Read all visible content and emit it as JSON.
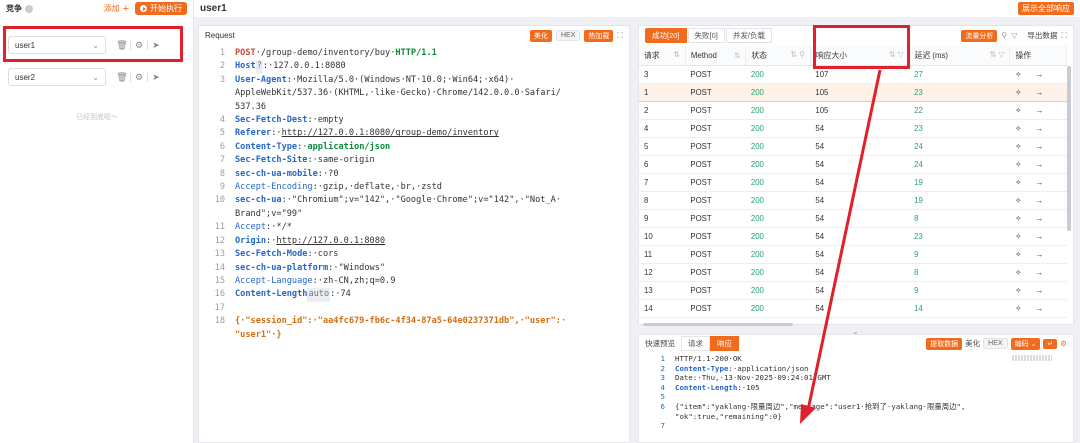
{
  "left": {
    "title": "竞争",
    "add_label": "添加",
    "run_label": "开始执行",
    "users": [
      {
        "name": "user1"
      },
      {
        "name": "user2"
      }
    ],
    "empty_hint": "已经到底啦～"
  },
  "header": {
    "title": "user1",
    "show_all_label": "展示全部响应"
  },
  "request": {
    "title": "Request",
    "tools": [
      "美化",
      "HEX",
      "热加载"
    ],
    "lines": [
      {
        "n": "1",
        "parts": [
          {
            "t": "POST",
            "c": "kw"
          },
          {
            "t": "·/group-demo/inventory/buy·",
            "c": ""
          },
          {
            "t": "HTTP/1.1",
            "c": "green"
          }
        ]
      },
      {
        "n": "2",
        "parts": [
          {
            "t": "Host",
            "c": "hn"
          },
          {
            "t": "?",
            "c": "hl"
          },
          {
            "t": ":·127.0.0.1:8080",
            "c": ""
          }
        ]
      },
      {
        "n": "3",
        "parts": [
          {
            "t": "User-Agent",
            "c": "hn"
          },
          {
            "t": ":·Mozilla/5.0·(Windows·NT·10.0;·Win64;·x64)·",
            "c": ""
          }
        ]
      },
      {
        "n": "",
        "parts": [
          {
            "t": "AppleWebKit/537.36·(KHTML,·like·Gecko)·Chrome/142.0.0.0·Safari/",
            "c": ""
          }
        ]
      },
      {
        "n": "",
        "parts": [
          {
            "t": "537.36",
            "c": ""
          }
        ]
      },
      {
        "n": "4",
        "parts": [
          {
            "t": "Sec-Fetch-Dest",
            "c": "hn"
          },
          {
            "t": ":·empty",
            "c": ""
          }
        ]
      },
      {
        "n": "5",
        "parts": [
          {
            "t": "Referer",
            "c": "hn"
          },
          {
            "t": ":·",
            "c": ""
          },
          {
            "t": "http://127.0.0.1:8080/group-demo/inventory",
            "c": "ul"
          }
        ]
      },
      {
        "n": "6",
        "parts": [
          {
            "t": "Content-Type",
            "c": "hn"
          },
          {
            "t": ":·",
            "c": ""
          },
          {
            "t": "application/json",
            "c": "green"
          }
        ]
      },
      {
        "n": "7",
        "parts": [
          {
            "t": "Sec-Fetch-Site",
            "c": "hn"
          },
          {
            "t": ":·same-origin",
            "c": ""
          }
        ]
      },
      {
        "n": "8",
        "parts": [
          {
            "t": "sec-ch-ua-mobile",
            "c": "hn"
          },
          {
            "t": ":·?0",
            "c": ""
          }
        ]
      },
      {
        "n": "9",
        "parts": [
          {
            "t": "Accept-Encoding",
            "c": "hn2"
          },
          {
            "t": ":·gzip,·deflate,·br,·zstd",
            "c": ""
          }
        ]
      },
      {
        "n": "10",
        "parts": [
          {
            "t": "sec-ch-ua",
            "c": "hn"
          },
          {
            "t": ":·\"Chromium\";v=\"142\",·\"Google·Chrome\";v=\"142\",·\"Not_A·",
            "c": ""
          }
        ]
      },
      {
        "n": "",
        "parts": [
          {
            "t": "Brand\";v=\"99\"",
            "c": ""
          }
        ]
      },
      {
        "n": "11",
        "parts": [
          {
            "t": "Accept",
            "c": "hn2"
          },
          {
            "t": ":·*/*",
            "c": ""
          }
        ]
      },
      {
        "n": "12",
        "parts": [
          {
            "t": "Origin",
            "c": "hn"
          },
          {
            "t": ":·",
            "c": ""
          },
          {
            "t": "http://127.0.0.1:8080",
            "c": "ul"
          }
        ]
      },
      {
        "n": "13",
        "parts": [
          {
            "t": "Sec-Fetch-Mode",
            "c": "hn"
          },
          {
            "t": ":·cors",
            "c": ""
          }
        ]
      },
      {
        "n": "14",
        "parts": [
          {
            "t": "sec-ch-ua-platform",
            "c": "hn"
          },
          {
            "t": ":·\"Windows\"",
            "c": ""
          }
        ]
      },
      {
        "n": "15",
        "parts": [
          {
            "t": "Accept-Language",
            "c": "hn2"
          },
          {
            "t": ":·zh-CN,zh;q=0.9",
            "c": ""
          }
        ]
      },
      {
        "n": "16",
        "parts": [
          {
            "t": "Content-Length",
            "c": "hn"
          },
          {
            "t": "auto",
            "c": "hl"
          },
          {
            "t": ":·74",
            "c": ""
          }
        ]
      },
      {
        "n": "17",
        "parts": [
          {
            "t": "",
            "c": ""
          }
        ]
      },
      {
        "n": "18",
        "parts": [
          {
            "t": "{·\"session_id\":·\"aa4fc679-fb6c-4f34-87a5-64e0237371db\",·\"user\":·",
            "c": "jk"
          }
        ]
      },
      {
        "n": "",
        "parts": [
          {
            "t": "\"user1\"·}",
            "c": "jk"
          }
        ]
      }
    ]
  },
  "results": {
    "tabs": [
      {
        "label": "成功[20]",
        "active": true
      },
      {
        "label": "失败[0]",
        "active": false
      },
      {
        "label": "并发/负载",
        "active": false
      }
    ],
    "flow_btn": "流量分析",
    "export_label": "导出数据",
    "columns": [
      "请求",
      "Method",
      "状态",
      "响应大小",
      "延迟 (ms)",
      "操作"
    ],
    "rows": [
      {
        "id": "3",
        "method": "POST",
        "status": "200",
        "size": "107",
        "latency": "27"
      },
      {
        "id": "1",
        "method": "POST",
        "status": "200",
        "size": "105",
        "latency": "23",
        "selected": true
      },
      {
        "id": "2",
        "method": "POST",
        "status": "200",
        "size": "105",
        "latency": "22"
      },
      {
        "id": "4",
        "method": "POST",
        "status": "200",
        "size": "54",
        "latency": "23"
      },
      {
        "id": "5",
        "method": "POST",
        "status": "200",
        "size": "54",
        "latency": "24"
      },
      {
        "id": "6",
        "method": "POST",
        "status": "200",
        "size": "54",
        "latency": "24"
      },
      {
        "id": "7",
        "method": "POST",
        "status": "200",
        "size": "54",
        "latency": "19"
      },
      {
        "id": "8",
        "method": "POST",
        "status": "200",
        "size": "54",
        "latency": "19"
      },
      {
        "id": "9",
        "method": "POST",
        "status": "200",
        "size": "54",
        "latency": "8"
      },
      {
        "id": "10",
        "method": "POST",
        "status": "200",
        "size": "54",
        "latency": "23"
      },
      {
        "id": "11",
        "method": "POST",
        "status": "200",
        "size": "54",
        "latency": "9"
      },
      {
        "id": "12",
        "method": "POST",
        "status": "200",
        "size": "54",
        "latency": "8"
      },
      {
        "id": "13",
        "method": "POST",
        "status": "200",
        "size": "54",
        "latency": "9"
      },
      {
        "id": "14",
        "method": "POST",
        "status": "200",
        "size": "54",
        "latency": "14"
      }
    ]
  },
  "response": {
    "label": "快速预览",
    "tabs": [
      {
        "label": "请求",
        "active": false
      },
      {
        "label": "响应",
        "active": true
      }
    ],
    "tools": [
      "提取数据",
      "美化",
      "HEX",
      "编码"
    ],
    "lines": [
      {
        "n": "1",
        "parts": [
          {
            "t": "HTTP/1.1·200·OK",
            "c": ""
          }
        ]
      },
      {
        "n": "2",
        "parts": [
          {
            "t": "Content-Type",
            "c": "hn"
          },
          {
            "t": ":·application/json",
            "c": ""
          }
        ]
      },
      {
        "n": "3",
        "parts": [
          {
            "t": "Date:·Thu,·13·Nov·2025·09:24:01·GMT",
            "c": ""
          }
        ]
      },
      {
        "n": "4",
        "parts": [
          {
            "t": "Content-Length",
            "c": "hn"
          },
          {
            "t": ":·105",
            "c": ""
          }
        ]
      },
      {
        "n": "5",
        "parts": [
          {
            "t": "",
            "c": ""
          }
        ]
      },
      {
        "n": "6",
        "parts": [
          {
            "t": "{\"item\":\"yaklang·限量周边\",\"message\":\"user1·抢到了·yaklang·限量周边\",",
            "c": ""
          }
        ]
      },
      {
        "n": "",
        "parts": [
          {
            "t": "\"ok\":true,\"remaining\":0}",
            "c": ""
          }
        ]
      },
      {
        "n": "7",
        "parts": [
          {
            "t": "",
            "c": ""
          }
        ]
      }
    ]
  },
  "colors": {
    "accent": "#f26b1d",
    "annotation": "#e0202b",
    "ok": "#25a36a"
  }
}
